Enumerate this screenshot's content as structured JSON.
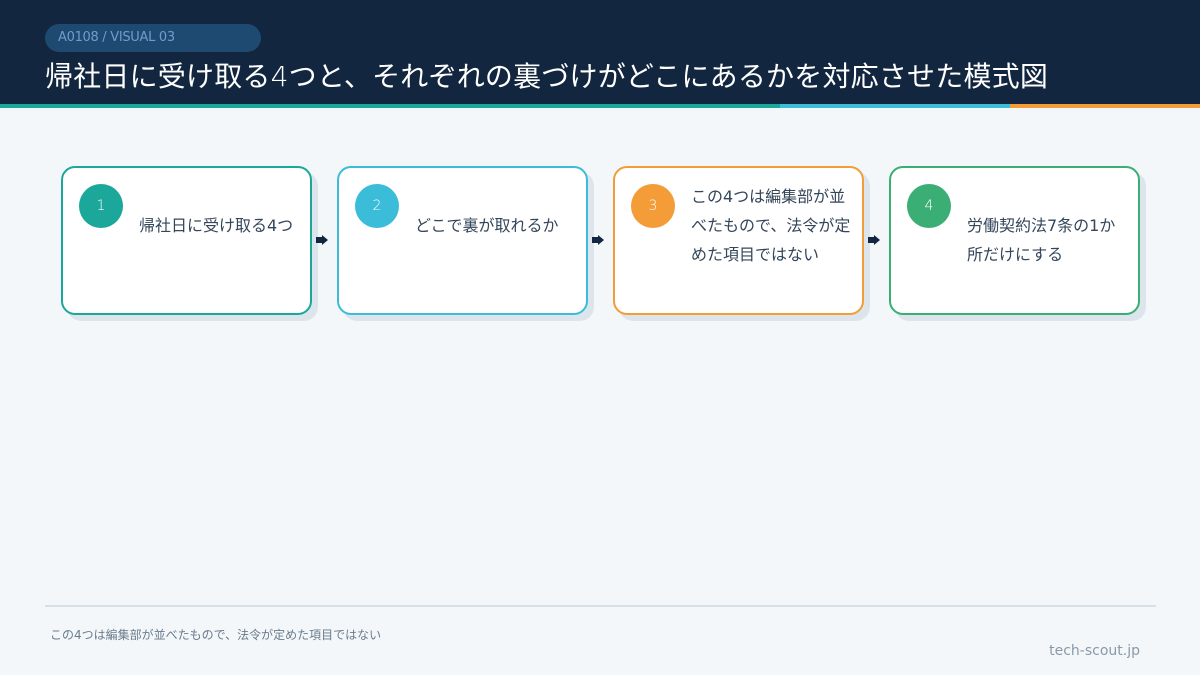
{
  "header": {
    "badge": "A0108 / VISUAL 03",
    "title": "帰社日に受け取る4つと、それぞれの裏づけがどこにあるかを対応させた模式図"
  },
  "colors": {
    "navy": "#12263f",
    "teal": "#1ba89a",
    "sky": "#3bbcd9",
    "orange": "#f39c38",
    "green": "#3aae74"
  },
  "steps": [
    {
      "number": "1",
      "text": "帰社日に受け取る4つ",
      "color": "#1ba89a"
    },
    {
      "number": "2",
      "text": "どこで裏が取れるか",
      "color": "#3bbcd9"
    },
    {
      "number": "3",
      "text": "この4つは編集部が並べたもので、法令が定めた項目ではない",
      "color": "#f39c38"
    },
    {
      "number": "4",
      "text": "労働契約法7条の1か所だけにする",
      "color": "#3aae74"
    }
  ],
  "footer": {
    "note": "この4つは編集部が並べたもので、法令が定めた項目ではない",
    "site": "tech-scout.jp"
  }
}
